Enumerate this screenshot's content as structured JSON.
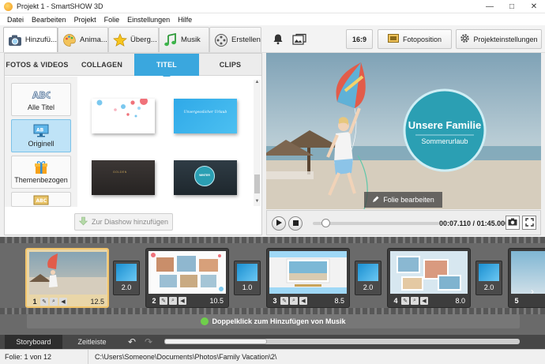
{
  "window": {
    "title": "Projekt 1 - SmartSHOW 3D",
    "minimize": "—",
    "maximize": "□",
    "close": "✕"
  },
  "menu": [
    "Datei",
    "Bearbeiten",
    "Projekt",
    "Folie",
    "Einstellungen",
    "Hilfe"
  ],
  "main_tabs": [
    {
      "label": "Hinzufü...",
      "icon": "camera-icon",
      "active": true
    },
    {
      "label": "Anima...",
      "icon": "palette-icon",
      "active": false
    },
    {
      "label": "Überg...",
      "icon": "star-icon",
      "active": false
    },
    {
      "label": "Musik",
      "icon": "music-note-icon",
      "active": false
    },
    {
      "label": "Erstellen",
      "icon": "film-reel-icon",
      "active": false
    }
  ],
  "toolbar": {
    "aspect_ratio": "16:9",
    "slide_position": "Fotoposition",
    "project_settings": "Projekteinstellungen"
  },
  "subtabs": [
    {
      "label": "FOTOS & VIDEOS",
      "active": false
    },
    {
      "label": "COLLAGEN",
      "active": false
    },
    {
      "label": "TITEL",
      "active": true
    },
    {
      "label": "CLIPS",
      "active": false
    }
  ],
  "categories": [
    {
      "label": "Alle Titel",
      "icon": "abc-icon",
      "active": false
    },
    {
      "label": "Originell",
      "icon": "monitor-icon",
      "active": true
    },
    {
      "label": "Themenbezogen",
      "icon": "gift-icon",
      "active": false
    },
    {
      "label": "",
      "icon": "abc-icon",
      "active": false
    }
  ],
  "title_templates": [
    {
      "style": "bubbles-white"
    },
    {
      "style": "blue-script",
      "caption": "Unvergesslicher Urlaub"
    },
    {
      "style": "dark-plain",
      "caption": "GOLDEN"
    },
    {
      "style": "dark-circle",
      "caption": "WINTER"
    }
  ],
  "add_button": "Zur Diashow hinzufügen",
  "preview": {
    "title": "Unsere Familie",
    "subtitle": "Sommerurlaub",
    "edit_button": "Folie bearbeiten"
  },
  "player": {
    "time_current": "00:07.110",
    "time_total": "01:45.000",
    "position": 0.07
  },
  "slides": [
    {
      "num": "1",
      "duration": "12.5",
      "active": true,
      "transition": "2.0"
    },
    {
      "num": "2",
      "duration": "10.5",
      "active": false,
      "transition": "1.0"
    },
    {
      "num": "3",
      "duration": "8.5",
      "active": false,
      "transition": "2.0"
    },
    {
      "num": "4",
      "duration": "8.0",
      "active": false,
      "transition": "2.0"
    },
    {
      "num": "5",
      "duration": "",
      "active": false,
      "transition": ""
    }
  ],
  "music_hint": "Doppelklick zum Hinzufügen von Musik",
  "bottom_tabs": [
    {
      "label": "Storyboard",
      "active": true
    },
    {
      "label": "Zeitleiste",
      "active": false
    }
  ],
  "status": {
    "slide_count": "Folie: 1 von 12",
    "path": "C:\\Users\\Someone\\Documents\\Photos\\Family Vacation\\2\\"
  },
  "colors": {
    "accent": "#3aa7de",
    "selected_slide": "#f2c46a"
  }
}
